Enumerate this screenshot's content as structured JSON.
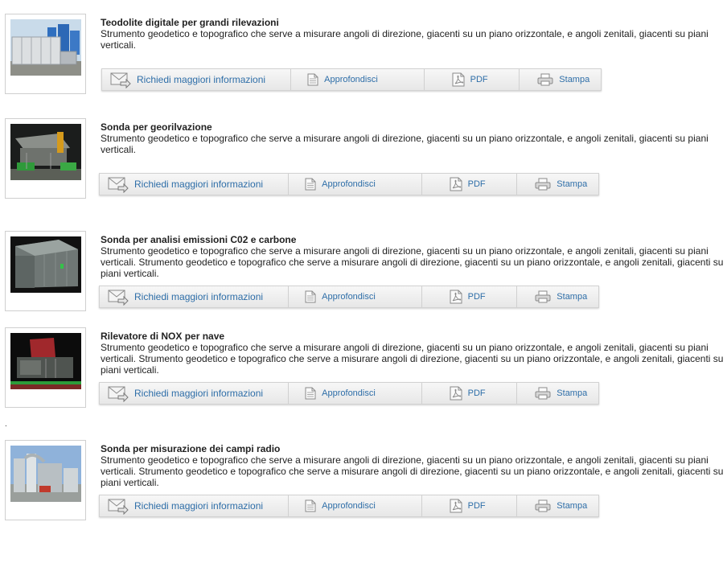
{
  "actions": {
    "info": "Richiedi maggiori informazioni",
    "more": "Approfondisci",
    "pdf": "PDF",
    "print": "Stampa"
  },
  "stray_mark": ".",
  "products": [
    {
      "title": "Teodolite digitale per grandi rilevazioni",
      "description": "Strumento geodetico e topografico che serve a misurare angoli di direzione, giacenti su un piano orizzontale, e angoli zenitali, giacenti su piani verticali.",
      "image": "container-plant-photo"
    },
    {
      "title": "Sonda per georilvazione",
      "description": "Strumento geodetico e topografico che serve a misurare angoli di direzione, giacenti su un piano orizzontale, e angoli zenitali, giacenti su piani verticali.",
      "image": "machinery-photo"
    },
    {
      "title": "Sonda per analisi emissioni C02 e carbone",
      "description": "Strumento geodetico e topografico che serve a misurare angoli di direzione, giacenti su un piano orizzontale, e angoli zenitali, giacenti su piani verticali. Strumento geodetico e topografico che serve a misurare angoli di direzione, giacenti su un piano orizzontale, e angoli zenitali, giacenti su piani verticali.",
      "image": "cabinet-unit-photo"
    },
    {
      "title": "Rilevatore di NOX per nave",
      "description": "Strumento geodetico e topografico che serve a misurare angoli di direzione, giacenti su un piano orizzontale, e angoli zenitali, giacenti su piani verticali. Strumento geodetico e topografico che serve a misurare angoli di direzione, giacenti su un piano orizzontale, e angoli zenitali, giacenti su piani verticali.",
      "image": "ship-engine-photo"
    },
    {
      "title": "Sonda per misurazione dei campi radio",
      "description": "Strumento geodetico e topografico che serve a misurare angoli di direzione, giacenti su un piano orizzontale, e angoli zenitali, giacenti su piani verticali. Strumento geodetico e topografico che serve a misurare angoli di direzione, giacenti su un piano orizzontale, e angoli zenitali, giacenti su piani verticali.",
      "image": "industrial-plant-photo"
    }
  ]
}
